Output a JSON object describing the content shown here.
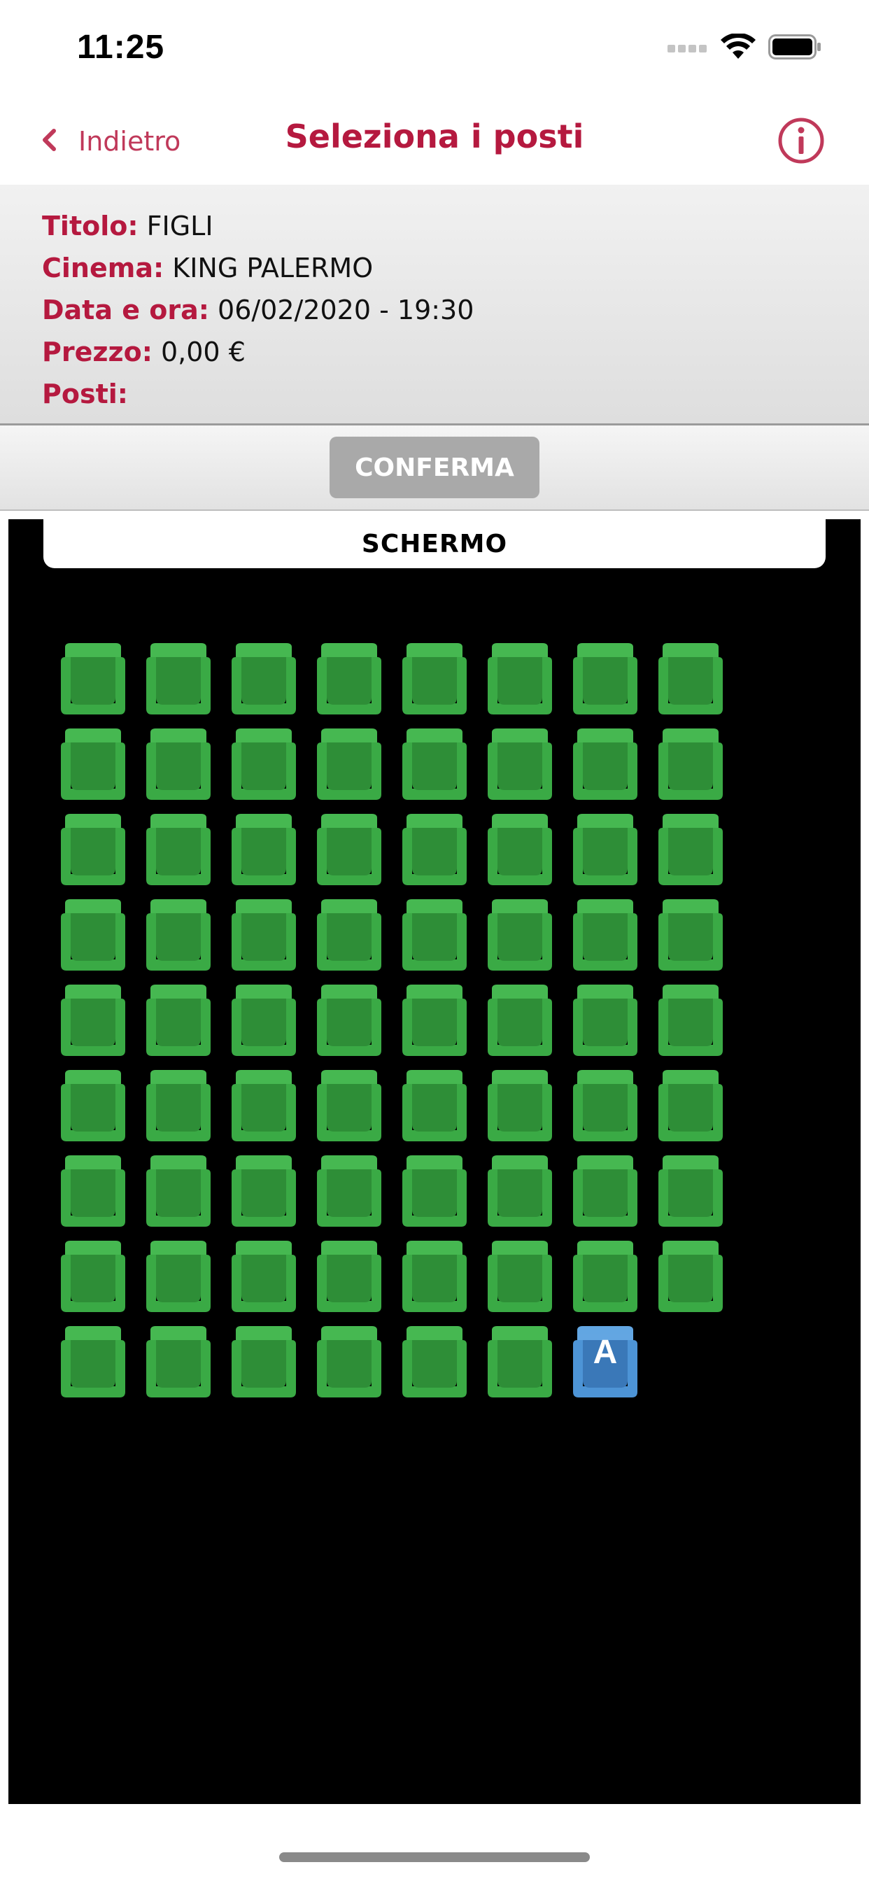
{
  "status_bar": {
    "time": "11:25",
    "icons": [
      "signal-dots-icon",
      "wifi-icon",
      "battery-icon"
    ]
  },
  "nav": {
    "back_label": "Indietro",
    "title": "Seleziona i posti",
    "info_icon": "info-icon"
  },
  "info": {
    "title_key": "Titolo:",
    "title_value": "FIGLI",
    "cinema_key": "Cinema:",
    "cinema_value": "KING PALERMO",
    "datetime_key": "Data e ora:",
    "datetime_value": "06/02/2020 - 19:30",
    "price_key": "Prezzo:",
    "price_value": "0,00 €",
    "seats_key": "Posti:",
    "seats_value": ""
  },
  "confirm_label": "CONFERMA",
  "screen_label": "SCHERMO",
  "seat_map": {
    "rows": [
      [
        "available",
        "available",
        "available",
        "available",
        "available",
        "available",
        "available",
        "available"
      ],
      [
        "available",
        "available",
        "available",
        "available",
        "available",
        "available",
        "available",
        "available"
      ],
      [
        "available",
        "available",
        "available",
        "available",
        "available",
        "available",
        "available",
        "available"
      ],
      [
        "available",
        "available",
        "available",
        "available",
        "available",
        "available",
        "available",
        "available"
      ],
      [
        "available",
        "available",
        "available",
        "available",
        "available",
        "available",
        "available",
        "available"
      ],
      [
        "available",
        "available",
        "available",
        "available",
        "available",
        "available",
        "available",
        "available"
      ],
      [
        "available",
        "available",
        "available",
        "available",
        "available",
        "available",
        "available",
        "available"
      ],
      [
        "available",
        "available",
        "available",
        "available",
        "available",
        "available",
        "available",
        "available"
      ],
      [
        "available",
        "available",
        "available",
        "available",
        "available",
        "available",
        "special"
      ]
    ],
    "special_seat_letter": "A"
  },
  "colors": {
    "accent": "#b5193f",
    "seat_available": "#33a340",
    "seat_special": "#3b82c4",
    "confirm_disabled": "#a9a9a9"
  }
}
